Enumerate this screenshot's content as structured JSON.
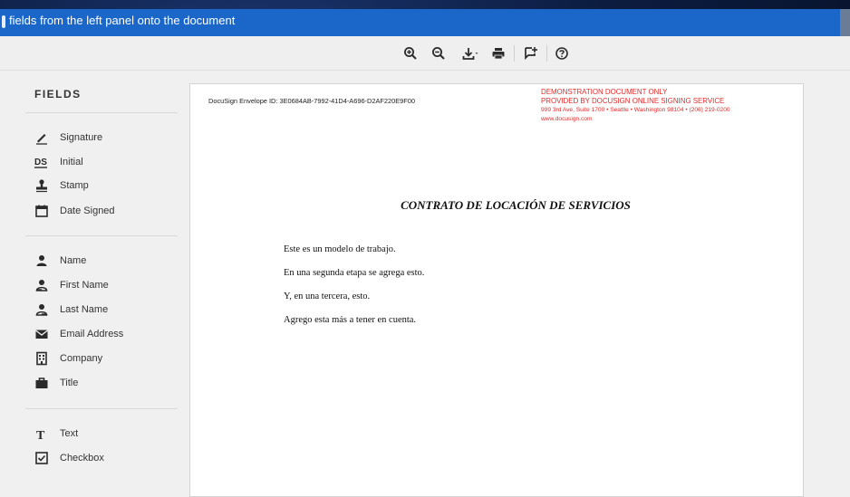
{
  "banner": {
    "text": "fields from the left panel onto the document"
  },
  "toolbar": {
    "buttons": [
      {
        "name": "zoom-in",
        "icon": "zoom-in-icon"
      },
      {
        "name": "zoom-out",
        "icon": "zoom-out-icon"
      },
      {
        "name": "download",
        "icon": "download-icon"
      },
      {
        "name": "print",
        "icon": "print-icon"
      },
      {
        "name": "comment",
        "icon": "add-comment-icon"
      },
      {
        "name": "help",
        "icon": "help-icon"
      }
    ]
  },
  "sidebar": {
    "title": "FIELDS",
    "groups": [
      [
        {
          "label": "Signature",
          "icon": "signature-pen-icon"
        },
        {
          "label": "Initial",
          "icon": "initial-ds-icon"
        },
        {
          "label": "Stamp",
          "icon": "stamp-icon"
        },
        {
          "label": "Date Signed",
          "icon": "calendar-icon"
        }
      ],
      [
        {
          "label": "Name",
          "icon": "person-icon"
        },
        {
          "label": "First Name",
          "icon": "person-first-icon"
        },
        {
          "label": "Last Name",
          "icon": "person-last-icon"
        },
        {
          "label": "Email Address",
          "icon": "envelope-icon"
        },
        {
          "label": "Company",
          "icon": "building-icon"
        },
        {
          "label": "Title",
          "icon": "briefcase-icon"
        }
      ],
      [
        {
          "label": "Text",
          "icon": "text-t-icon"
        },
        {
          "label": "Checkbox",
          "icon": "checkbox-icon"
        }
      ]
    ]
  },
  "document": {
    "envelope_id": "DocuSign Envelope ID: 3E0684AB-7992-41D4-A696-D2AF220E9F00",
    "demo_lines": [
      "DEMONSTRATION DOCUMENT ONLY",
      "PROVIDED BY DOCUSIGN ONLINE SIGNING SERVICE",
      "999 3rd Ave, Suite 1700  • Seattle • Washington 98104 • (206) 219-0200",
      "www.docusign.com"
    ],
    "title": "CONTRATO DE LOCACIÓN DE SERVICIOS",
    "paragraphs": [
      "Este es un modelo de trabajo.",
      "En una segunda etapa se agrega esto.",
      "Y, en una tercera, esto.",
      "Agrego esta más a tener en cuenta."
    ]
  },
  "colors": {
    "banner": "#1b66c9",
    "demo_red": "#e32b2b",
    "panel": "#f0f0f0"
  }
}
